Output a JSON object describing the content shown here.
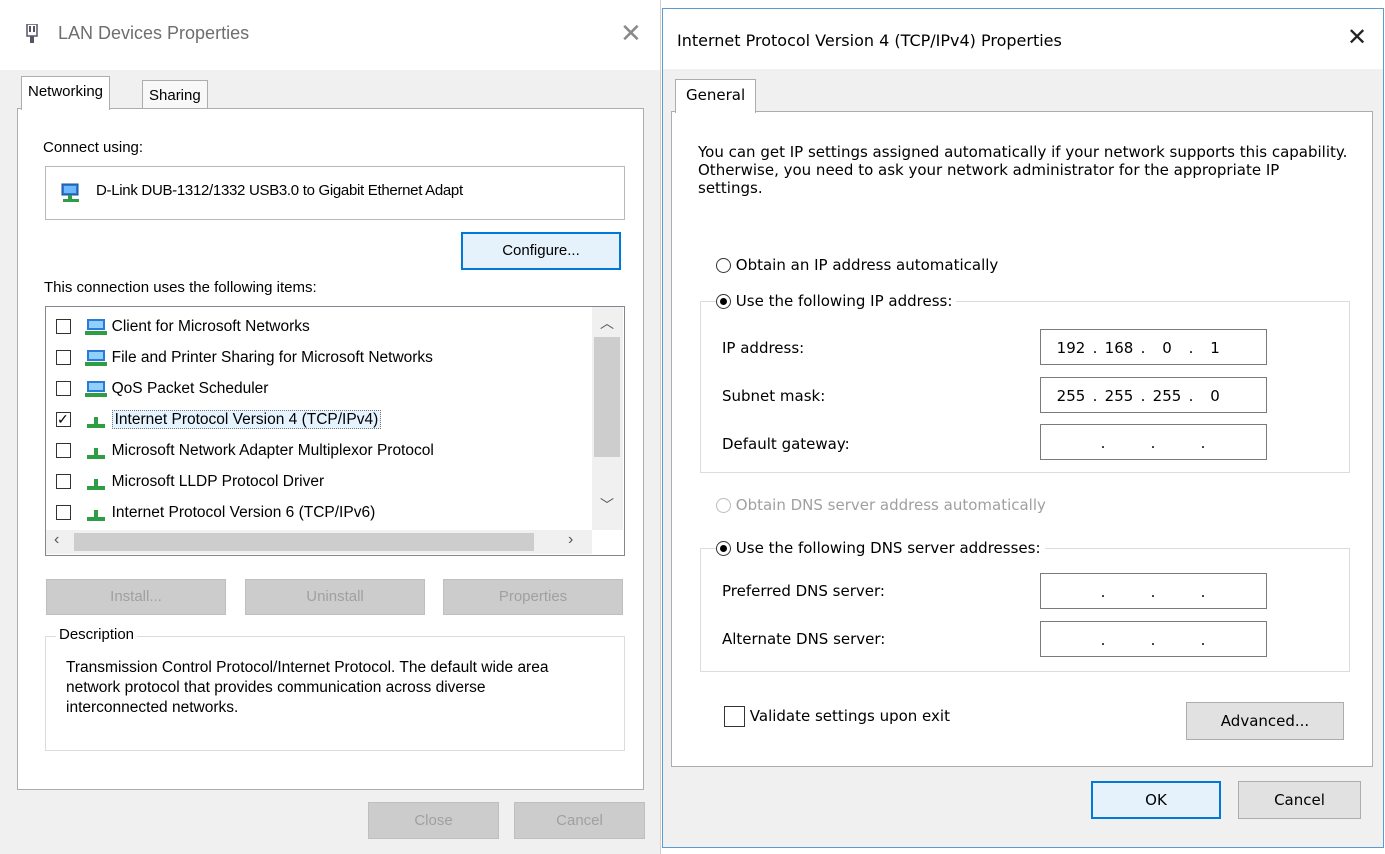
{
  "left_dialog": {
    "title": "LAN Devices Properties",
    "tabs": [
      "Networking",
      "Sharing"
    ],
    "connect_using_label": "Connect using:",
    "adapter_name": "D-Link DUB-1312/1332 USB3.0 to Gigabit Ethernet Adapt",
    "configure_label": "Configure...",
    "items_label": "This connection uses the following items:",
    "items": [
      {
        "label": "Client for Microsoft Networks",
        "checked": false
      },
      {
        "label": "File and Printer Sharing for Microsoft Networks",
        "checked": false
      },
      {
        "label": "QoS Packet Scheduler",
        "checked": false
      },
      {
        "label": "Internet Protocol Version 4 (TCP/IPv4)",
        "checked": true
      },
      {
        "label": "Microsoft Network Adapter Multiplexor Protocol",
        "checked": false
      },
      {
        "label": "Microsoft LLDP Protocol Driver",
        "checked": false
      },
      {
        "label": "Internet Protocol Version 6 (TCP/IPv6)",
        "checked": false
      }
    ],
    "install_label": "Install...",
    "uninstall_label": "Uninstall",
    "properties_label": "Properties",
    "description_label": "Description",
    "description_text": "Transmission Control Protocol/Internet Protocol. The default wide area network protocol that provides communication across diverse interconnected networks.",
    "close_label": "Close",
    "cancel_label": "Cancel"
  },
  "right_dialog": {
    "title": "Internet Protocol Version 4 (TCP/IPv4) Properties",
    "tab": "General",
    "intro": "You can get IP settings assigned automatically if your network supports this capability. Otherwise, you need to ask your network administrator for the appropriate IP settings.",
    "obtain_ip_auto": "Obtain an IP address automatically",
    "use_following_ip": "Use the following IP address:",
    "ip_address_label": "IP address:",
    "ip_address": [
      "192",
      "168",
      "0",
      "1"
    ],
    "subnet_mask_label": "Subnet mask:",
    "subnet_mask": [
      "255",
      "255",
      "255",
      "0"
    ],
    "default_gateway_label": "Default gateway:",
    "obtain_dns_auto": "Obtain DNS server address automatically",
    "use_following_dns": "Use the following DNS server addresses:",
    "preferred_dns_label": "Preferred DNS server:",
    "alternate_dns_label": "Alternate DNS server:",
    "validate_label": "Validate settings upon exit",
    "advanced_label": "Advanced...",
    "ok_label": "OK",
    "cancel_label": "Cancel"
  },
  "colors": {
    "accent": "#0078d7",
    "window_border": "#5b9bd5",
    "dialog_bg": "#f0f0f0"
  }
}
